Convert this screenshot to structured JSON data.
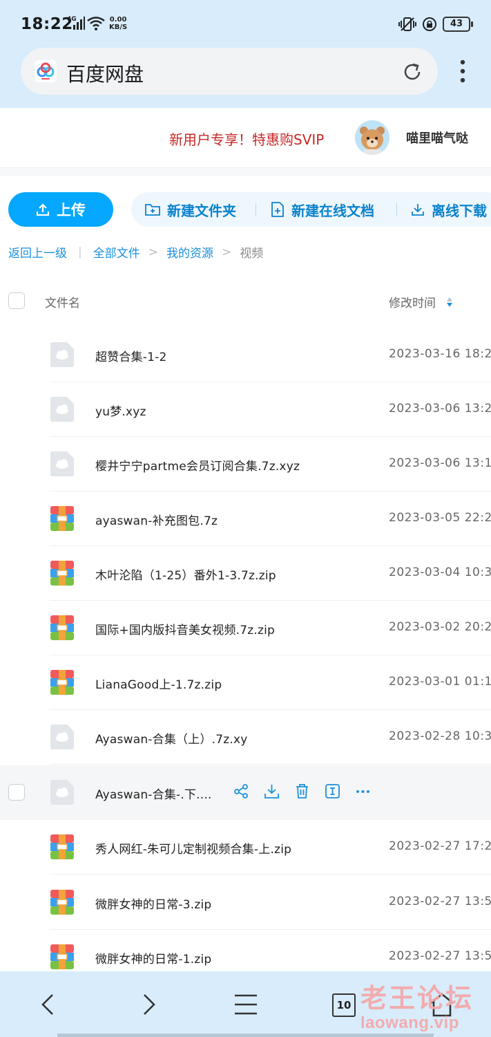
{
  "status_bar": {
    "time": "18:22",
    "network_type": "4G",
    "net_speed_value": "0.00",
    "net_speed_unit": "KB/S",
    "battery": "43"
  },
  "browser": {
    "page_title": "百度网盘"
  },
  "promo": {
    "text": "新用户专享！特惠购SVIP",
    "username": "喵里喵气哒"
  },
  "toolbar": {
    "upload_label": "上传",
    "new_folder_label": "新建文件夹",
    "new_doc_label": "新建在线文档",
    "offline_download_label": "离线下载"
  },
  "breadcrumb": {
    "back": "返回上一级",
    "root": "全部文件",
    "level1": "我的资源",
    "current": "视频",
    "sep_bar": "|",
    "sep_arrow": ">"
  },
  "list_header": {
    "name": "文件名",
    "time": "修改时间"
  },
  "files": [
    {
      "name": "超赞合集-1-2",
      "time": "2023-03-16 18:2",
      "icon": "cloud-file-icon"
    },
    {
      "name": "yu梦.xyz",
      "time": "2023-03-06 13:2",
      "icon": "cloud-file-icon"
    },
    {
      "name": "樱井宁宁partme会员订阅合集.7z.xyz",
      "time": "2023-03-06 13:1",
      "icon": "cloud-file-icon"
    },
    {
      "name": "ayaswan-补充图包.7z",
      "time": "2023-03-05 22:2",
      "icon": "archive-icon"
    },
    {
      "name": "木叶沦陷（1-25）番外1-3.7z.zip",
      "time": "2023-03-04 10:3",
      "icon": "archive-icon"
    },
    {
      "name": "国际+国内版抖音美女视频.7z.zip",
      "time": "2023-03-02 20:2",
      "icon": "archive-icon"
    },
    {
      "name": "LianaGood上-1.7z.zip",
      "time": "2023-03-01 01:1",
      "icon": "archive-icon"
    },
    {
      "name": "Ayaswan-合集（上）.7z.xy",
      "time": "2023-02-28 10:3",
      "icon": "cloud-file-icon"
    },
    {
      "name": "Ayaswan-合集-.下....",
      "time": "",
      "icon": "cloud-file-icon"
    },
    {
      "name": "秀人网红-朱可儿定制视频合集-上.zip",
      "time": "2023-02-27 17:2",
      "icon": "archive-icon"
    },
    {
      "name": "微胖女神的日常-3.zip",
      "time": "2023-02-27 13:5",
      "icon": "archive-icon"
    },
    {
      "name": "微胖女神的日常-1.zip",
      "time": "2023-02-27 13:5",
      "icon": "archive-icon"
    }
  ],
  "nav": {
    "tab_count": "10"
  },
  "watermark": {
    "cn": "老王论坛",
    "en": "laowang.vip"
  },
  "colors": {
    "accent": "#06a7ff",
    "link": "#1a8fdd",
    "promo": "#c62828",
    "bar_bg": "#d8ecfb"
  }
}
